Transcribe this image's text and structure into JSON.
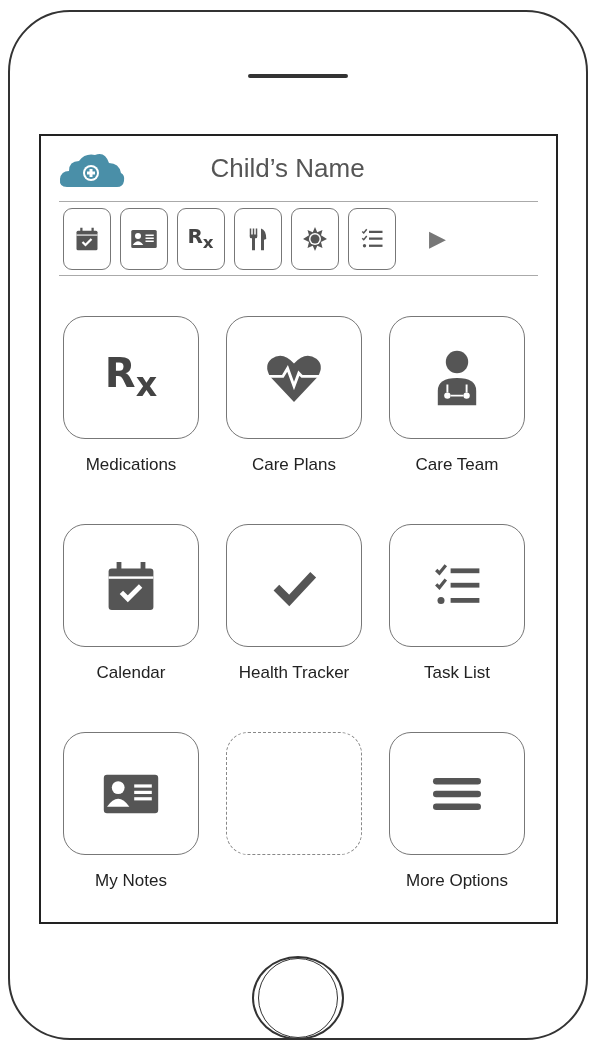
{
  "header": {
    "title": "Child’s Name"
  },
  "toolbar": {
    "items": [
      {
        "kind": "calendar"
      },
      {
        "kind": "card"
      },
      {
        "kind": "rx",
        "glyph": "R$_{x}$"
      },
      {
        "kind": "utensils"
      },
      {
        "kind": "sun"
      },
      {
        "kind": "tasks"
      }
    ],
    "next": "▶"
  },
  "tiles": [
    {
      "kind": "rx",
      "glyph": "R$_{x}$",
      "label": "Medications"
    },
    {
      "kind": "heart",
      "label": "Care Plans"
    },
    {
      "kind": "doctor",
      "label": "Care Team"
    },
    {
      "kind": "calendar",
      "label": "Calendar"
    },
    {
      "kind": "check",
      "label": "Health Tracker"
    },
    {
      "kind": "tasks",
      "label": "Task List"
    },
    {
      "kind": "card",
      "label": "My Notes"
    },
    {
      "kind": "empty"
    },
    {
      "kind": "menu",
      "label": "More Options"
    }
  ]
}
